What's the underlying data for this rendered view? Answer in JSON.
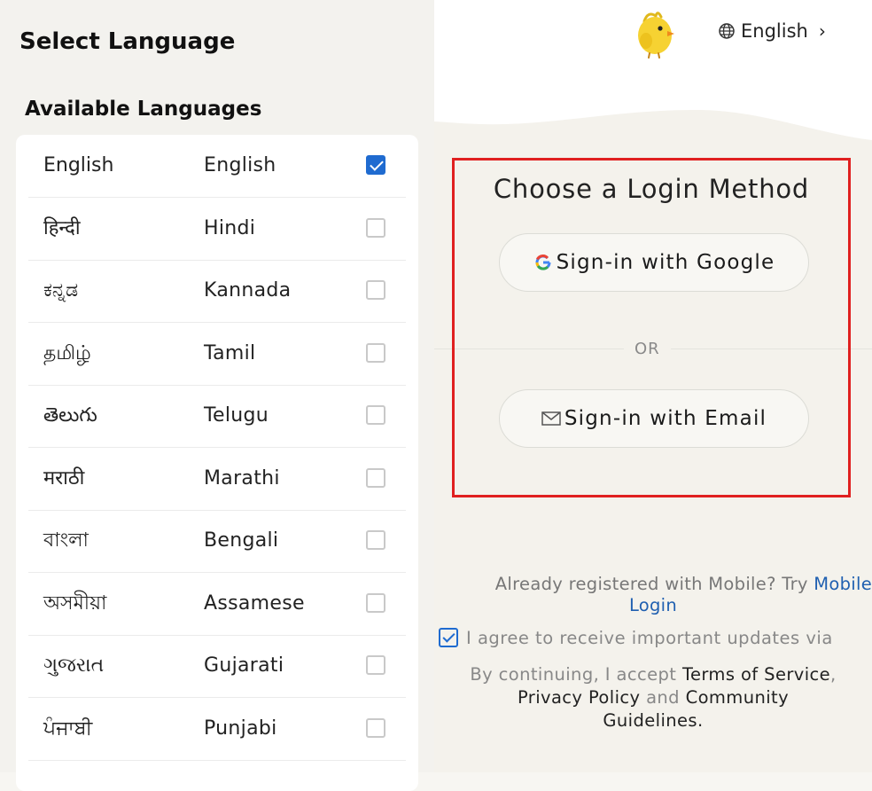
{
  "left": {
    "title": "Select Language",
    "subtitle": "Available Languages",
    "languages": [
      {
        "native": "English",
        "english": "English",
        "checked": true
      },
      {
        "native": "हिन्दी",
        "english": "Hindi",
        "checked": false
      },
      {
        "native": "ಕನ್ನಡ",
        "english": "Kannada",
        "checked": false
      },
      {
        "native": "தமிழ்",
        "english": "Tamil",
        "checked": false
      },
      {
        "native": "తెలుగు",
        "english": "Telugu",
        "checked": false
      },
      {
        "native": "मराठी",
        "english": "Marathi",
        "checked": false
      },
      {
        "native": "বাংলা",
        "english": "Bengali",
        "checked": false
      },
      {
        "native": "অসমীয়া",
        "english": "Assamese",
        "checked": false
      },
      {
        "native": "ગુજરાત",
        "english": "Gujarati",
        "checked": false
      },
      {
        "native": "ਪੰਜਾਬੀ",
        "english": "Punjabi",
        "checked": false
      }
    ]
  },
  "right": {
    "language_switch": {
      "icon": "globe-icon",
      "label": "English"
    },
    "login_title": "Choose a Login Method",
    "google_button": {
      "icon": "google-icon",
      "label": "Sign-in with Google"
    },
    "or_label": "OR",
    "email_button": {
      "icon": "mail-icon",
      "label": "Sign-in with Email"
    },
    "mobile_prompt": "Already registered with Mobile? Try ",
    "mobile_link_1": "Mobile",
    "mobile_link_2": "Login",
    "agree_checked": true,
    "agree_text": "I agree to receive important updates via",
    "terms_prefix": "By continuing, I accept ",
    "terms_of_service": "Terms of Service",
    "terms_comma": ",",
    "privacy_policy": "Privacy Policy",
    "terms_and": " and ",
    "community": "Community",
    "guidelines": "Guidelines",
    "terms_period": "."
  },
  "colors": {
    "accent": "#1f6bd0",
    "highlight_border": "#e02020",
    "link": "#1f5fb0",
    "logo_yellow": "#f6d232"
  }
}
